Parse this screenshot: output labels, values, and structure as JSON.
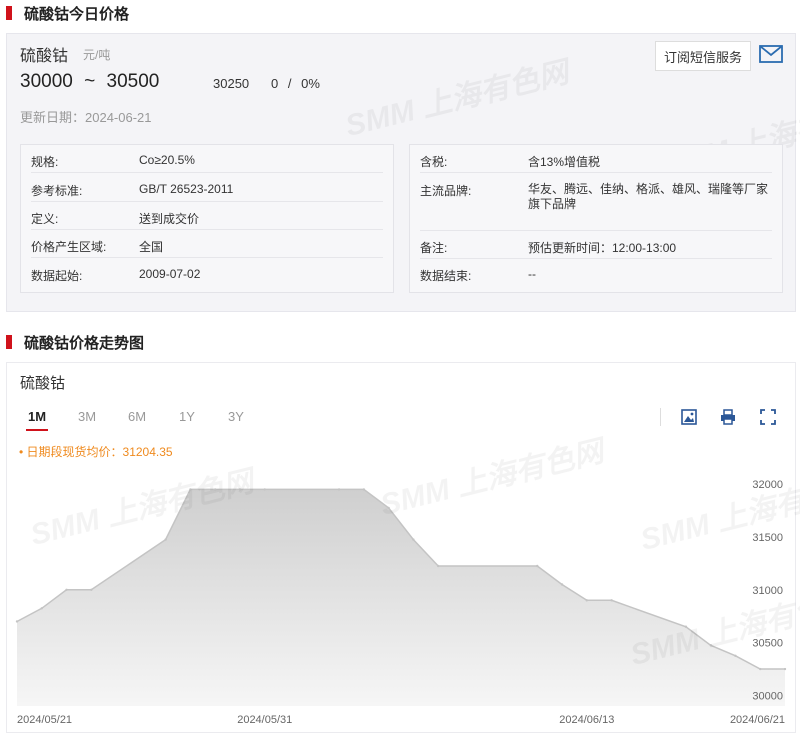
{
  "section1": {
    "title": "硫酸钴今日价格"
  },
  "product": {
    "name": "硫酸钴",
    "unit": "元/吨",
    "price_low": "30000",
    "tilde": "~",
    "price_high": "30500",
    "avg": "30250",
    "change": "0",
    "sep": "/",
    "change_pct": "0%",
    "update_label": "更新日期：",
    "update_date": "2024-06-21",
    "sms_label": "订阅短信服务",
    "mail_icon": "mail-icon"
  },
  "info_left": [
    {
      "label": "规格:",
      "value": "Co≥20.5%"
    },
    {
      "label": "参考标准:",
      "value": "GB/T 26523-2011"
    },
    {
      "label": "定义:",
      "value": "送到成交价"
    },
    {
      "label": "价格产生区域:",
      "value": "全国"
    },
    {
      "label": "数据起始:",
      "value": "2009-07-02"
    }
  ],
  "info_right": [
    {
      "label": "含税:",
      "value": "含13%增值税"
    },
    {
      "label": "主流品牌:",
      "value": "华友、腾远、佳纳、格派、雄风、瑞隆等厂家旗下品牌"
    },
    {
      "label": "备注:",
      "value": "预估更新时间：12:00-13:00"
    },
    {
      "label": "数据结束:",
      "value": "--"
    }
  ],
  "watermark": "SMM 上海有色网",
  "section2": {
    "title": "硫酸钴价格走势图"
  },
  "chart_panel": {
    "product": "硫酸钴",
    "tabs": [
      "1M",
      "3M",
      "6M",
      "1Y",
      "3Y"
    ],
    "active_tab": "1M",
    "tools": [
      "image-download-icon",
      "print-icon",
      "fullscreen-icon"
    ],
    "avg_text": "• 日期段现货均价：31204.35"
  },
  "chart_data": {
    "type": "area",
    "title": "",
    "xlabel": "",
    "ylabel": "",
    "x": [
      "2024-05-21",
      "2024-05-22",
      "2024-05-23",
      "2024-05-24",
      "2024-05-27",
      "2024-05-28",
      "2024-05-29",
      "2024-05-30",
      "2024-05-31",
      "2024-06-03",
      "2024-06-04",
      "2024-06-05",
      "2024-06-06",
      "2024-06-07",
      "2024-06-11",
      "2024-06-12",
      "2024-06-13",
      "2024-06-14",
      "2024-06-17",
      "2024-06-18",
      "2024-06-19",
      "2024-06-20",
      "2024-06-21"
    ],
    "series": [
      {
        "values": [
          30700,
          30825,
          31000,
          31000,
          31475,
          31950,
          31950,
          31950,
          31950,
          31950,
          31950,
          31775,
          31475,
          31225,
          31225,
          31050,
          30900,
          30900,
          30650,
          30475,
          30375,
          30250,
          30250
        ]
      }
    ],
    "x_tick_labels": [
      "2024/05/21",
      "2024/05/31",
      "2024/06/13",
      "2024/06/21"
    ],
    "y_ticks": [
      30000,
      30500,
      31000,
      31500,
      32000
    ],
    "ylim": [
      29900,
      32200
    ],
    "grid": false,
    "y_axis_side": "right",
    "colors": {
      "line": "#c4c4c4",
      "fill_top": "#cfcfcf",
      "fill_bottom": "#f6f6f6",
      "tick": "#666666"
    }
  },
  "colors": {
    "accent": "#d0121b",
    "avg": "#ef8a1e",
    "link": "#2b6cb0"
  }
}
